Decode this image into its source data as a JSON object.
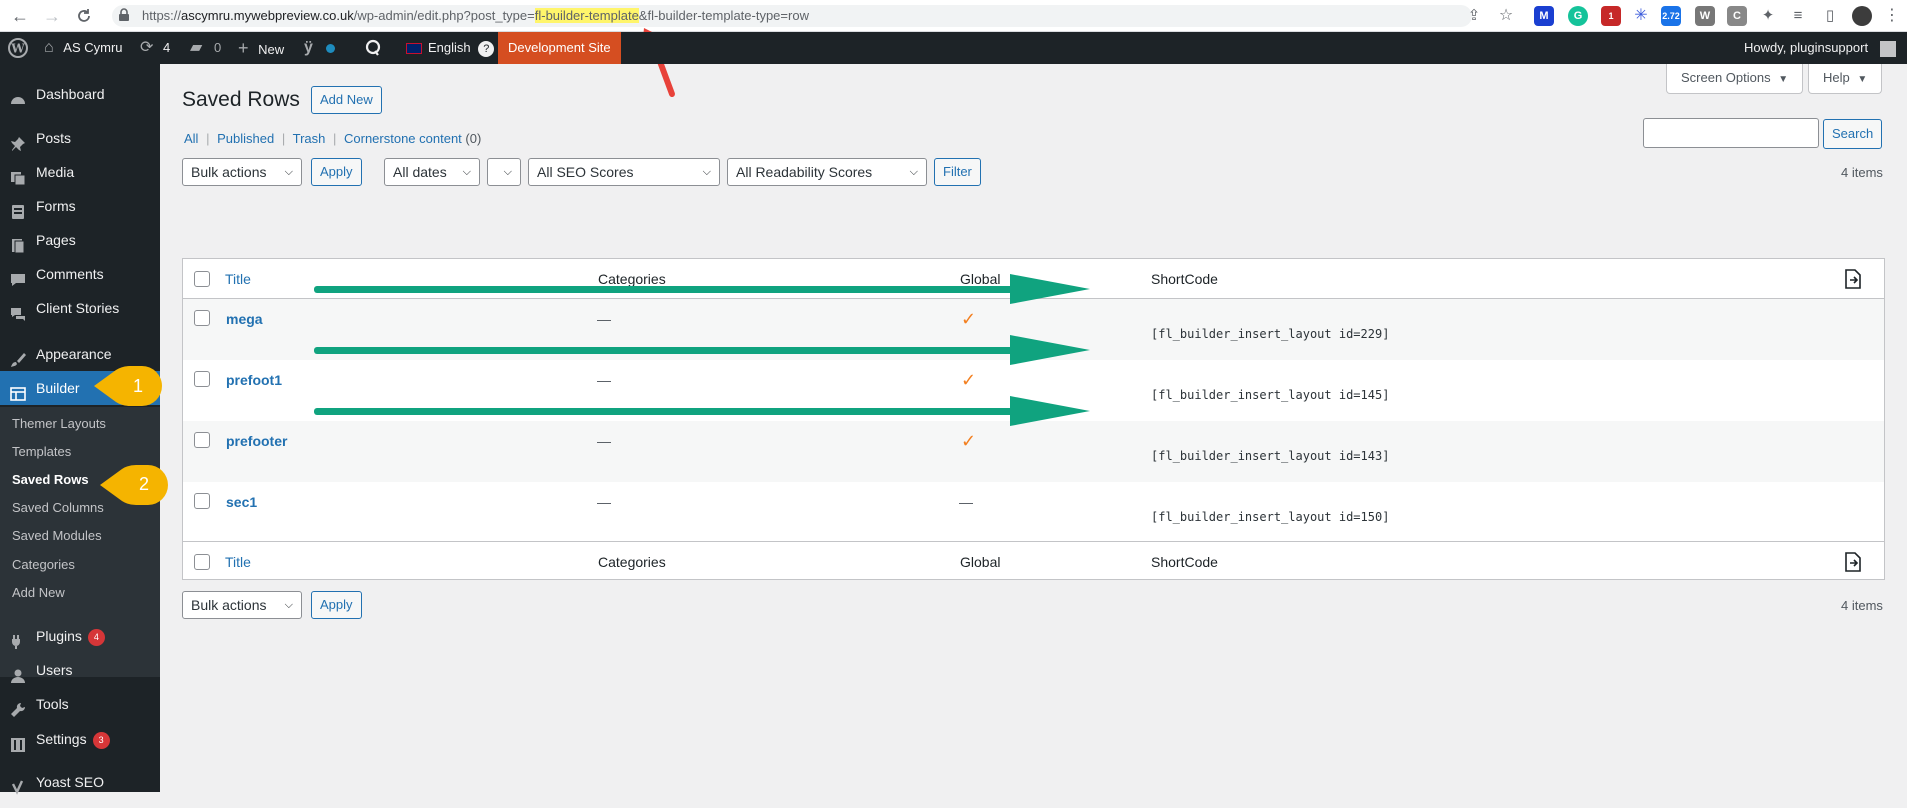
{
  "browser": {
    "url_prefix": "https://",
    "url_domain": "ascymru.mywebpreview.co.uk",
    "url_path": "/wp-admin/edit.php?post_type=",
    "url_highlight": "fl-builder-template",
    "url_suffix": "&fl-builder-template-type=row",
    "ext_badge_1": "1",
    "ext_badge_2": "2.72"
  },
  "adminbar": {
    "site_name": "AS Cymru",
    "updates_count": "4",
    "comments_count": "0",
    "new_label": "New",
    "language": "English",
    "language_badge": "?",
    "dev_site": "Development Site",
    "howdy": "Howdy, pluginsupport"
  },
  "sidebar": {
    "dashboard": "Dashboard",
    "posts": "Posts",
    "media": "Media",
    "forms": "Forms",
    "pages": "Pages",
    "comments": "Comments",
    "client_stories": "Client Stories",
    "appearance": "Appearance",
    "builder": "Builder",
    "sub": {
      "themer_layouts": "Themer Layouts",
      "templates": "Templates",
      "saved_rows": "Saved Rows",
      "saved_columns": "Saved Columns",
      "saved_modules": "Saved Modules",
      "categories": "Categories",
      "add_new": "Add New"
    },
    "plugins": "Plugins",
    "plugins_badge": "4",
    "users": "Users",
    "tools": "Tools",
    "settings": "Settings",
    "settings_badge": "3",
    "yoast": "Yoast SEO"
  },
  "callouts": {
    "one": "1",
    "two": "2"
  },
  "main": {
    "page_title": "Saved Rows",
    "add_new": "Add New",
    "screen_options": "Screen Options",
    "help": "Help",
    "filters": {
      "all": "All",
      "published": "Published",
      "trash": "Trash",
      "cornerstone": "Cornerstone content",
      "cornerstone_count": "(0)"
    },
    "search_button": "Search",
    "bulk_actions": "Bulk actions",
    "apply": "Apply",
    "all_dates": "All dates",
    "seo_scores": "All SEO Scores",
    "readability": "All Readability Scores",
    "filter_button": "Filter",
    "items_count": "4 items",
    "columns": {
      "title": "Title",
      "categories": "Categories",
      "global": "Global",
      "shortcode": "ShortCode"
    },
    "rows": [
      {
        "title": "mega",
        "categories": "—",
        "global": "✓",
        "shortcode": "[fl_builder_insert_layout id=229]"
      },
      {
        "title": "prefoot1",
        "categories": "—",
        "global": "✓",
        "shortcode": "[fl_builder_insert_layout id=145]"
      },
      {
        "title": "prefooter",
        "categories": "—",
        "global": "✓",
        "shortcode": "[fl_builder_insert_layout id=143]"
      },
      {
        "title": "sec1",
        "categories": "—",
        "global": "—",
        "shortcode": "[fl_builder_insert_layout id=150]"
      }
    ]
  },
  "colors": {
    "admin_dark": "#1d2327",
    "wp_blue": "#2271b1",
    "dev_site": "#d54e21",
    "check_orange": "#f38020",
    "arrow_green": "#10a37f",
    "callout_yellow": "#f5b400",
    "url_highlight": "#fff56b"
  }
}
